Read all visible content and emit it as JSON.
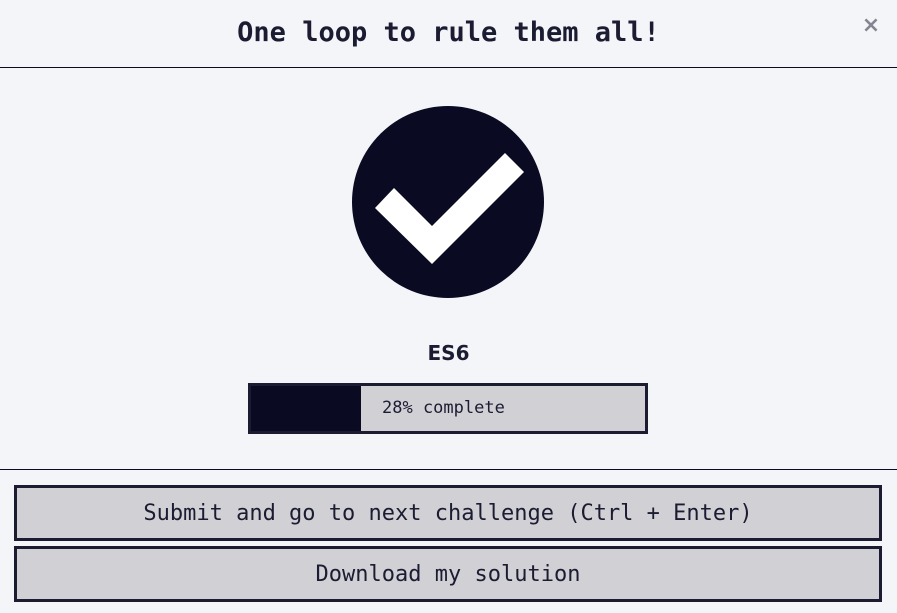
{
  "modal": {
    "title": "One loop to rule them all!",
    "close_label": "×"
  },
  "completion": {
    "icon": "check-circle-icon",
    "certification": "ES6",
    "progress_percent": 28,
    "progress_label": "28% complete"
  },
  "actions": {
    "submit_label": "Submit and go to next challenge (Ctrl + Enter)",
    "download_label": "Download my solution"
  },
  "colors": {
    "background": "#f4f5f8",
    "dark": "#0a0a23",
    "text": "#1b1b32",
    "button_bg": "#d0d0d5",
    "close_gray": "#858591",
    "check_white": "#ffffff"
  }
}
